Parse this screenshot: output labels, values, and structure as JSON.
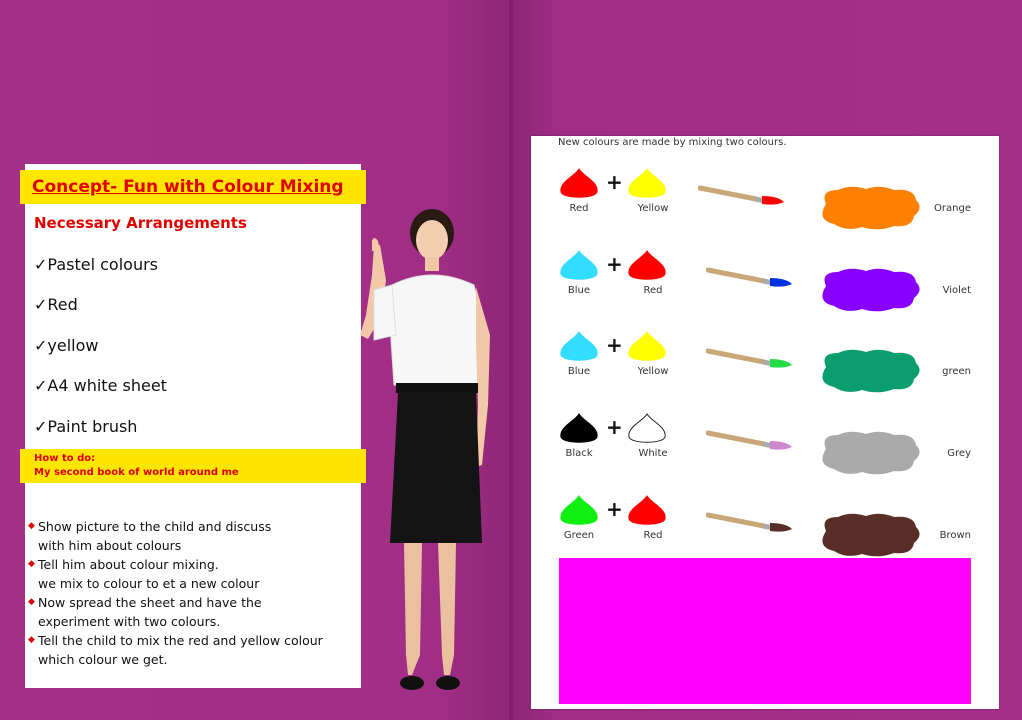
{
  "left_page": {
    "concept_title": "Concept- Fun with Colour Mixing",
    "arrangements_title": "Necessary Arrangements",
    "requirements": [
      "✓Pastel colours",
      "✓Red",
      "✓yellow",
      "✓A4 white sheet",
      "✓Paint brush"
    ],
    "how_to_label": "How to do:",
    "book_title": "My second book of world around me",
    "steps": [
      "Show picture to the child and discuss with him about colours",
      "Tell him about colour mixing. we mix to colour to et a new colour",
      "Now spread the sheet and have the experiment with two colours.",
      "Tell the child to mix the red and yellow colour which colour we get."
    ],
    "steps_lines": [
      [
        "Show picture to the child and discuss",
        "with him about colours"
      ],
      [
        "Tell him about colour mixing.",
        "we mix to colour to et a new colour"
      ],
      [
        "Now spread the sheet and have the",
        "experiment with two colours."
      ],
      [
        "Tell the child to mix the red and yellow colour",
        "which colour we get."
      ]
    ]
  },
  "right_page": {
    "intro": "New colours are made by mixing two colours.",
    "plus_sign": "+",
    "mixes": [
      {
        "a": "Red",
        "a_color": "#ff0000",
        "b": "Yellow",
        "b_color": "#ffff00",
        "result": "Orange",
        "result_color": "#ff7f00",
        "brush_tip": "#ff0000"
      },
      {
        "a": "Blue",
        "a_color": "#33ddff",
        "b": "Red",
        "b_color": "#ff0000",
        "result": "Violet",
        "result_color": "#8800ff",
        "brush_tip": "#0033dd"
      },
      {
        "a": "Blue",
        "a_color": "#33ddff",
        "b": "Yellow",
        "b_color": "#ffff00",
        "result": "green",
        "result_color": "#0a9e6e",
        "brush_tip": "#22dd44"
      },
      {
        "a": "Black",
        "a_color": "#000000",
        "b": "White",
        "b_color": "#ffffff",
        "result": "Grey",
        "result_color": "#aaaaaa",
        "brush_tip": "#cc88cc"
      },
      {
        "a": "Green",
        "a_color": "#11ee11",
        "b": "Red",
        "b_color": "#ff0000",
        "result": "Brown",
        "result_color": "#5a2e28",
        "brush_tip": "#5a2e28"
      }
    ]
  },
  "colors": {
    "background": "#a12e86",
    "highlight": "#ffe600",
    "accent_red": "#e00000",
    "magenta_box": "#ff00ff"
  }
}
